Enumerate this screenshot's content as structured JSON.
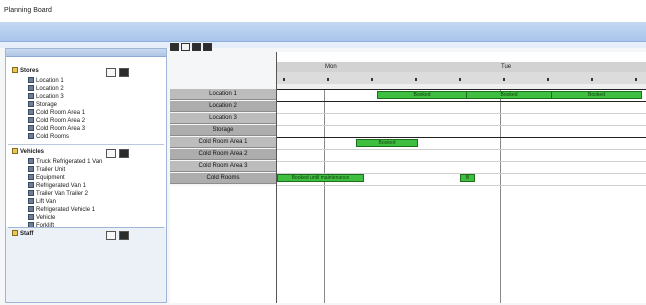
{
  "window": {
    "title": "Planning Board"
  },
  "tree": {
    "header": [
      "",
      "",
      ""
    ],
    "groups": [
      {
        "label": "Stores",
        "items": [
          "Location 1",
          "Location 2",
          "Location 3",
          "Storage",
          "Cold Room Area 1",
          "Cold Room Area 2",
          "Cold Room Area 3",
          "Cold Rooms"
        ]
      },
      {
        "label": "Vehicles",
        "items": [
          "Truck Refrigerated 1 Van",
          "Trailer Unit",
          "Equipment",
          "Refrigerated Van 1",
          "Trailer Van Trailer 2",
          "Lift Van",
          "Refrigerated Vehicle 1",
          "Vehicle",
          "Forklift"
        ]
      },
      {
        "label": "Staff",
        "items": []
      }
    ]
  },
  "toolbar": {
    "buttons": [
      "zoom-in",
      "zoom-out",
      "prev",
      "next"
    ]
  },
  "schedule": {
    "rows": [
      "Location 1",
      "Location 2",
      "Location 3",
      "Storage",
      "Cold Room Area 1",
      "Cold Room Area 2",
      "Cold Room Area 3",
      "Cold Rooms"
    ],
    "timeline_labels": [
      "Mon",
      "Tue"
    ],
    "bars": [
      {
        "row": 0,
        "label": "Booked"
      },
      {
        "row": 0,
        "label": "Booked"
      },
      {
        "row": 0,
        "label": "Booked"
      },
      {
        "row": 4,
        "label": "Booked"
      },
      {
        "row": 7,
        "label": "Booked until maintenance"
      },
      {
        "row": 7,
        "label": "B"
      }
    ]
  },
  "colors": {
    "bar": "#3fbf3f",
    "header": "#a9c5ea",
    "row_label": "#bcbcbc"
  }
}
